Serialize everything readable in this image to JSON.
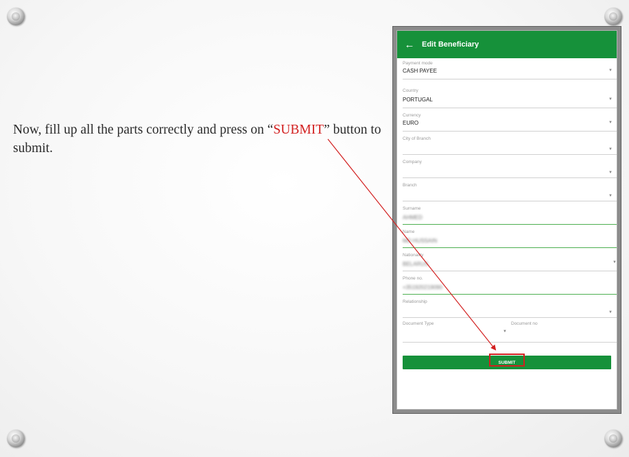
{
  "slide": {
    "instruction_before": "Now, fill up all the parts correctly and press on “",
    "instruction_highlight": "SUBMIT",
    "instruction_after": "” button to submit.",
    "highlight_color": "#d21f1f",
    "accent_color": "#16913a"
  },
  "app": {
    "back_icon": "←",
    "title": "Edit Beneficiary",
    "fields": [
      {
        "label": "Payment mode",
        "value": "CASH PAYEE"
      },
      {
        "label": "Country",
        "value": "PORTUGAL"
      },
      {
        "label": "Currency",
        "value": "EURO"
      },
      {
        "label": "City of Branch",
        "value": ""
      },
      {
        "label": "Company",
        "value": ""
      },
      {
        "label": "Branch",
        "value": ""
      },
      {
        "label": "Surname",
        "value": "AHMED"
      },
      {
        "label": "Name",
        "value": "MD HUSSAIN"
      },
      {
        "label": "Nationality",
        "value": "BELARUS"
      },
      {
        "label": "Phone no.",
        "value": "+351920219090"
      },
      {
        "label": "Relationship",
        "value": ""
      }
    ],
    "document_type_label": "Document Type",
    "document_no_label": "Document no",
    "submit_label": "SUBMIT"
  }
}
